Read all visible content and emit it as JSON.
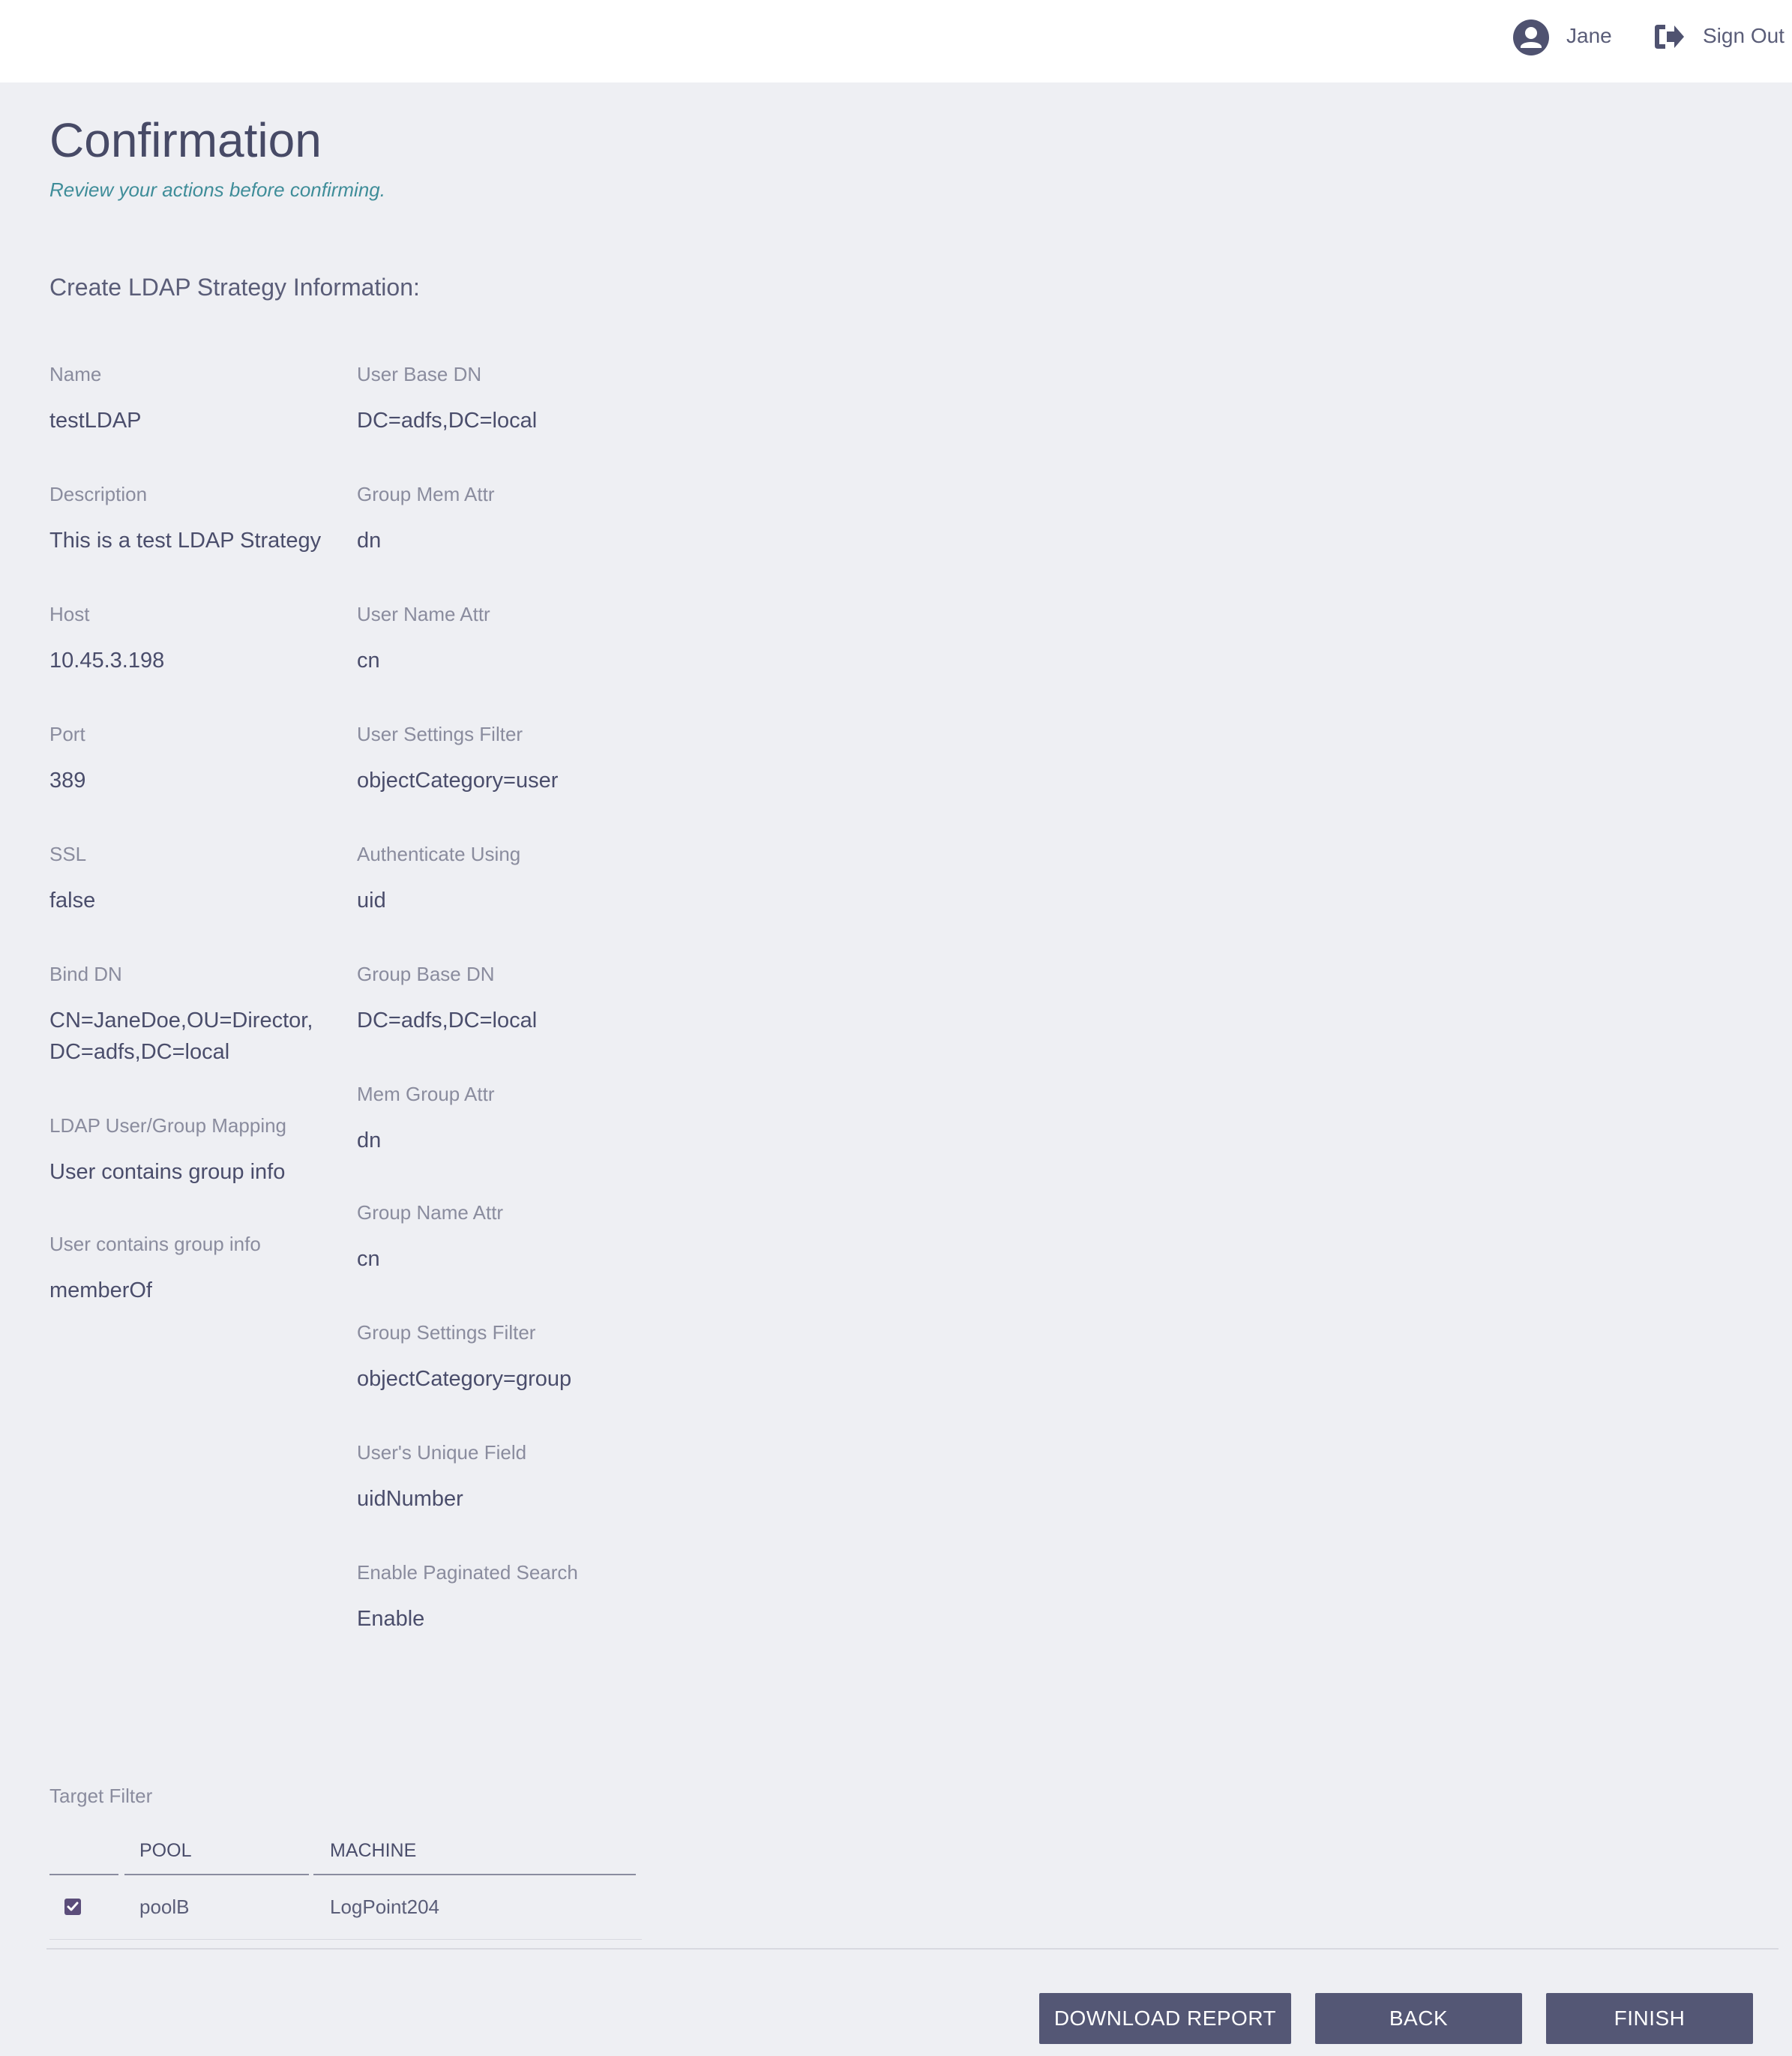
{
  "header": {
    "user_name": "Jane",
    "sign_out_label": "Sign Out",
    "user_icon": "user-circle-icon",
    "sign_out_icon": "sign-out-icon"
  },
  "page": {
    "title": "Confirmation",
    "subtitle": "Review your actions before confirming.",
    "section_title": "Create LDAP Strategy Information:"
  },
  "fields_left": [
    {
      "label": "Name",
      "value": "testLDAP"
    },
    {
      "label": "Description",
      "value": "This is a test LDAP Strategy"
    },
    {
      "label": "Host",
      "value": "10.45.3.198"
    },
    {
      "label": "Port",
      "value": "389"
    },
    {
      "label": "SSL",
      "value": "false"
    },
    {
      "label": "Bind DN",
      "value": "CN=JaneDoe,OU=Director,DC=adfs,DC=local"
    },
    {
      "label": "LDAP User/Group Mapping",
      "value": "User contains group info"
    },
    {
      "label": "User contains group info",
      "value": "memberOf"
    }
  ],
  "fields_right": [
    {
      "label": "User Base DN",
      "value": "DC=adfs,DC=local"
    },
    {
      "label": "Group Mem Attr",
      "value": "dn"
    },
    {
      "label": "User Name Attr",
      "value": "cn"
    },
    {
      "label": "User Settings Filter",
      "value": "objectCategory=user"
    },
    {
      "label": "Authenticate Using",
      "value": "uid"
    },
    {
      "label": "Group Base DN",
      "value": "DC=adfs,DC=local"
    },
    {
      "label": "Mem Group Attr",
      "value": "dn"
    },
    {
      "label": "Group Name Attr",
      "value": "cn"
    },
    {
      "label": "Group Settings Filter",
      "value": "objectCategory=group"
    },
    {
      "label": "User's Unique Field",
      "value": "uidNumber"
    },
    {
      "label": "Enable Paginated Search",
      "value": "Enable"
    }
  ],
  "target_filter": {
    "label": "Target Filter",
    "columns": [
      "POOL",
      "MACHINE"
    ],
    "rows": [
      {
        "checked": true,
        "pool": "poolB",
        "machine": "LogPoint204"
      }
    ]
  },
  "buttons": {
    "download_report": "DOWNLOAD REPORT",
    "back": "BACK",
    "finish": "FINISH"
  },
  "colors": {
    "accent": "#545775",
    "subtitle": "#3f8d99",
    "background": "#eeeff3"
  }
}
